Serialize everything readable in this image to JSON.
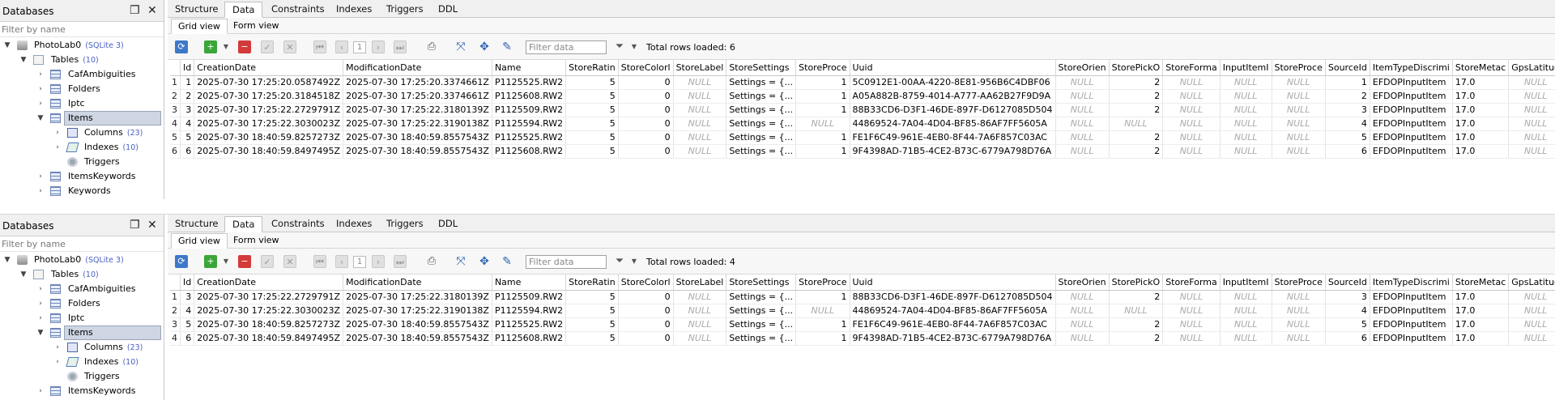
{
  "left": {
    "header": "Databases",
    "filter_placeholder": "Filter by name",
    "db": {
      "name": "PhotoLab0",
      "version": "(SQLite 3)"
    },
    "tables": {
      "label": "Tables",
      "count": "(10)"
    },
    "items": [
      "CafAmbiguities",
      "Folders",
      "Iptc",
      "Items"
    ],
    "columns": {
      "label": "Columns",
      "count": "(23)"
    },
    "indexes": {
      "label": "Indexes",
      "count": "(10)"
    },
    "triggers": "Triggers",
    "after": [
      "ItemsKeywords",
      "Keywords"
    ]
  },
  "tabs": [
    "Structure",
    "Data",
    "Constraints",
    "Indexes",
    "Triggers",
    "DDL"
  ],
  "subtabs": [
    "Grid view",
    "Form view"
  ],
  "filter_data_placeholder": "Filter data",
  "page_number": "1",
  "columns": [
    "Id",
    "CreationDate",
    "ModificationDate",
    "Name",
    "StoreRatin",
    "StoreColorl",
    "StoreLabel",
    "StoreSettings",
    "StoreProce",
    "Uuid",
    "StoreOrien",
    "StorePickO",
    "StoreForma",
    "InputItemI",
    "StoreProce",
    "SourceId",
    "ItemTypeDiscrimi",
    "StoreMetac",
    "GpsLatitud",
    "GpsL"
  ],
  "grid1": {
    "rows_loaded": "Total rows loaded: 6",
    "rows": [
      [
        "1",
        "1",
        "2025-07-30 17:25:20.0587492Z",
        "2025-07-30 17:25:20.3374661Z",
        "P1125525.RW2",
        "5",
        "0",
        "NULL",
        "Settings = {...",
        "1",
        "5C0912E1-00AA-4220-8E81-956B6C4DBF06",
        "NULL",
        "2",
        "NULL",
        "NULL",
        "NULL",
        "1",
        "EFDOPInputItem",
        "17.0",
        "NULL"
      ],
      [
        "2",
        "2",
        "2025-07-30 17:25:20.3184518Z",
        "2025-07-30 17:25:20.3374661Z",
        "P1125608.RW2",
        "5",
        "0",
        "NULL",
        "Settings = {...",
        "1",
        "A05A882B-8759-4014-A777-AA62B27F9D9A",
        "NULL",
        "2",
        "NULL",
        "NULL",
        "NULL",
        "2",
        "EFDOPInputItem",
        "17.0",
        "NULL"
      ],
      [
        "3",
        "3",
        "2025-07-30 17:25:22.2729791Z",
        "2025-07-30 17:25:22.3180139Z",
        "P1125509.RW2",
        "5",
        "0",
        "NULL",
        "Settings = {...",
        "1",
        "88B33CD6-D3F1-46DE-897F-D6127085D504",
        "NULL",
        "2",
        "NULL",
        "NULL",
        "NULL",
        "3",
        "EFDOPInputItem",
        "17.0",
        "NULL"
      ],
      [
        "4",
        "4",
        "2025-07-30 17:25:22.3030023Z",
        "2025-07-30 17:25:22.3190138Z",
        "P1125594.RW2",
        "5",
        "0",
        "NULL",
        "Settings = {...",
        "NULL",
        "44869524-7A04-4D04-BF85-86AF7FF5605A",
        "NULL",
        "NULL",
        "NULL",
        "NULL",
        "NULL",
        "4",
        "EFDOPInputItem",
        "17.0",
        "NULL"
      ],
      [
        "5",
        "5",
        "2025-07-30 18:40:59.8257273Z",
        "2025-07-30 18:40:59.8557543Z",
        "P1125525.RW2",
        "5",
        "0",
        "NULL",
        "Settings = {...",
        "1",
        "FE1F6C49-961E-4EB0-8F44-7A6F857C03AC",
        "NULL",
        "2",
        "NULL",
        "NULL",
        "NULL",
        "5",
        "EFDOPInputItem",
        "17.0",
        "NULL"
      ],
      [
        "6",
        "6",
        "2025-07-30 18:40:59.8497495Z",
        "2025-07-30 18:40:59.8557543Z",
        "P1125608.RW2",
        "5",
        "0",
        "NULL",
        "Settings = {...",
        "1",
        "9F4398AD-71B5-4CE2-B73C-6779A798D76A",
        "NULL",
        "2",
        "NULL",
        "NULL",
        "NULL",
        "6",
        "EFDOPInputItem",
        "17.0",
        "NULL"
      ]
    ]
  },
  "grid2": {
    "rows_loaded": "Total rows loaded: 4",
    "rows": [
      [
        "1",
        "3",
        "2025-07-30 17:25:22.2729791Z",
        "2025-07-30 17:25:22.3180139Z",
        "P1125509.RW2",
        "5",
        "0",
        "NULL",
        "Settings = {...",
        "1",
        "88B33CD6-D3F1-46DE-897F-D6127085D504",
        "NULL",
        "2",
        "NULL",
        "NULL",
        "NULL",
        "3",
        "EFDOPInputItem",
        "17.0",
        "NULL",
        "NULL"
      ],
      [
        "2",
        "4",
        "2025-07-30 17:25:22.3030023Z",
        "2025-07-30 17:25:22.3190138Z",
        "P1125594.RW2",
        "5",
        "0",
        "NULL",
        "Settings = {...",
        "NULL",
        "44869524-7A04-4D04-BF85-86AF7FF5605A",
        "NULL",
        "NULL",
        "NULL",
        "NULL",
        "NULL",
        "4",
        "EFDOPInputItem",
        "17.0",
        "NULL",
        "NULL"
      ],
      [
        "3",
        "5",
        "2025-07-30 18:40:59.8257273Z",
        "2025-07-30 18:40:59.8557543Z",
        "P1125525.RW2",
        "5",
        "0",
        "NULL",
        "Settings = {...",
        "1",
        "FE1F6C49-961E-4EB0-8F44-7A6F857C03AC",
        "NULL",
        "2",
        "NULL",
        "NULL",
        "NULL",
        "5",
        "EFDOPInputItem",
        "17.0",
        "NULL",
        "NULL"
      ],
      [
        "4",
        "6",
        "2025-07-30 18:40:59.8497495Z",
        "2025-07-30 18:40:59.8557543Z",
        "P1125608.RW2",
        "5",
        "0",
        "NULL",
        "Settings = {...",
        "1",
        "9F4398AD-71B5-4CE2-B73C-6779A798D76A",
        "NULL",
        "2",
        "NULL",
        "NULL",
        "NULL",
        "6",
        "EFDOPInputItem",
        "17.0",
        "NULL",
        "NULL"
      ]
    ]
  }
}
